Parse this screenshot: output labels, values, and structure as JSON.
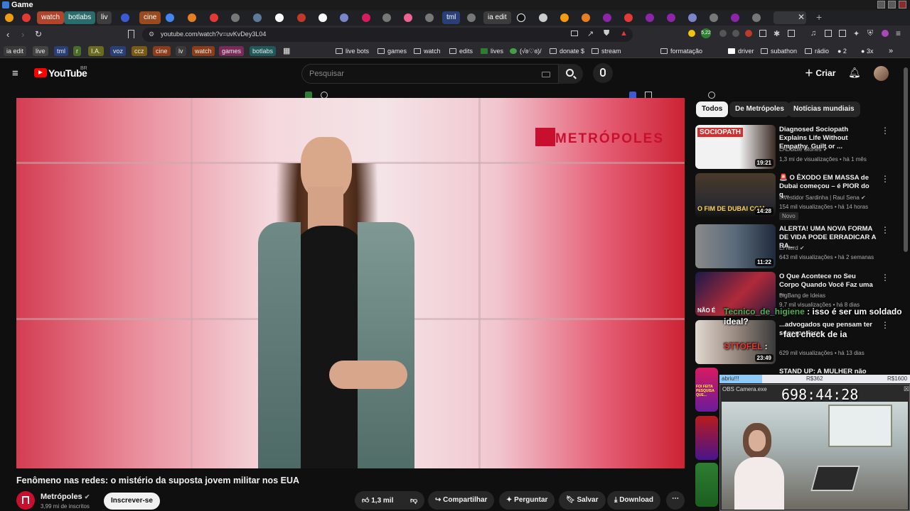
{
  "window": {
    "title": "Game"
  },
  "tabs": [
    {
      "label": "watch",
      "bg": "#b0452c"
    },
    {
      "label": "botlabs",
      "bg": "#2a6b6b"
    },
    {
      "label": "liv",
      "bg": "#3d3d3d"
    },
    {
      "label": "cine",
      "bg": "#9b4a1f"
    },
    {
      "label": "tml",
      "bg": "#2a3f78"
    },
    {
      "label": "ia edit",
      "bg": "#3c3c3c"
    }
  ],
  "address": {
    "url": "youtube.com/watch?v=uvKvDey3L04"
  },
  "bookmarks": {
    "chips": [
      {
        "label": "ia edit",
        "bg": "#3a3a3a"
      },
      {
        "label": "live",
        "bg": "#444"
      },
      {
        "label": "tml",
        "bg": "#2a3f78"
      },
      {
        "label": "r",
        "bg": "#4b6b2a"
      },
      {
        "label": "I.A.",
        "bg": "#6b6b1f"
      },
      {
        "label": "voz",
        "bg": "#2a3f78"
      },
      {
        "label": "ccz",
        "bg": "#7a5a14"
      },
      {
        "label": "cine",
        "bg": "#8b3d1a"
      },
      {
        "label": "lv",
        "bg": "#3a3a3a"
      },
      {
        "label": "watch",
        "bg": "#8b3d1a"
      },
      {
        "label": "games",
        "bg": "#7a2a5a"
      },
      {
        "label": "botlabs",
        "bg": "#1f5a5a"
      }
    ],
    "items": [
      "live bots",
      "games",
      "watch",
      "edits",
      "lives",
      "(√ʚ♡ɞ)/",
      "donate $",
      "stream",
      "formatação",
      "driver",
      "subathon",
      "rádio",
      "3x"
    ]
  },
  "youtube": {
    "logo_text": "YouTube",
    "region": "BR",
    "search_placeholder": "Pesquisar",
    "create_label": "Criar"
  },
  "video": {
    "brand": "METRÓPOLES",
    "title": "Fenômeno nas redes: o mistério da suposta jovem militar nos EUA"
  },
  "channel": {
    "name": "Metrópoles",
    "subscribers": "3,99 mi de inscritos",
    "subscribe_label": "Inscrever-se"
  },
  "actions": {
    "likes": "1,3 mil",
    "share": "Compartilhar",
    "ask": "Perguntar",
    "save": "Salvar",
    "download": "Download"
  },
  "filter_chips": [
    "Todos",
    "De Metrópoles",
    "Notícias mundiais"
  ],
  "recommendations": [
    {
      "title": "Diagnosed Sociopath Explains Life Without Empathy, Guilt or ...",
      "channel": "LADbible Stories",
      "meta": "1,3 mi de visualizações • há 1 mês",
      "duration": "19:21",
      "thumb_text": "SOCIOPATH",
      "badge": ""
    },
    {
      "title": "🚨 O ÊXODO EM MASSA de Dubai começou – é PIOR do q...",
      "channel": "Investidor Sardinha | Raul Sena",
      "meta": "154 mil visualizações • há 14 horas",
      "duration": "14:28",
      "thumb_text": "O FIM DE DUBAI COM...",
      "badge": "Novo"
    },
    {
      "title": "ALERTA! UMA NOVA FORMA DE VIDA PODE ERRADICAR A RA...",
      "channel": "El Nerd",
      "meta": "643 mil visualizações • há 2 semanas",
      "duration": "11:22",
      "thumb_text": "",
      "badge": ""
    },
    {
      "title": "O Que Acontece no Seu Corpo Quando Você Faz uma ...",
      "channel": "BigBang de Ideias",
      "meta": "9,7 mil visualizações • há 8 dias",
      "duration": "",
      "thumb_text": "NÃO É",
      "badge": ""
    },
    {
      "title": "...advogados que pensam ter superpoderes",
      "channel": "",
      "meta": "629 mil visualizações • há 13 dias",
      "duration": "23:49",
      "thumb_text": "",
      "badge": ""
    },
    {
      "title": "STAND UP: A MULHER não tem...",
      "channel": "",
      "meta": "",
      "duration": "",
      "thumb_text": "FOI FEITA PESQUISA QUE...",
      "badge": ""
    }
  ],
  "overlay": {
    "chat": [
      {
        "user": "Tecnico_de_higiene",
        "msg": ": isso é ser um soldado ideal?"
      },
      {
        "user": "",
        "msg": "fact check de ia"
      },
      {
        "user": "STTOFEL",
        "msg": ":"
      }
    ],
    "goal_label": "abriu!!!",
    "goal_current": "R$362",
    "goal_target": "R$1600",
    "camera_title": "OBS Camera.exe",
    "timer": "698:44:28"
  }
}
